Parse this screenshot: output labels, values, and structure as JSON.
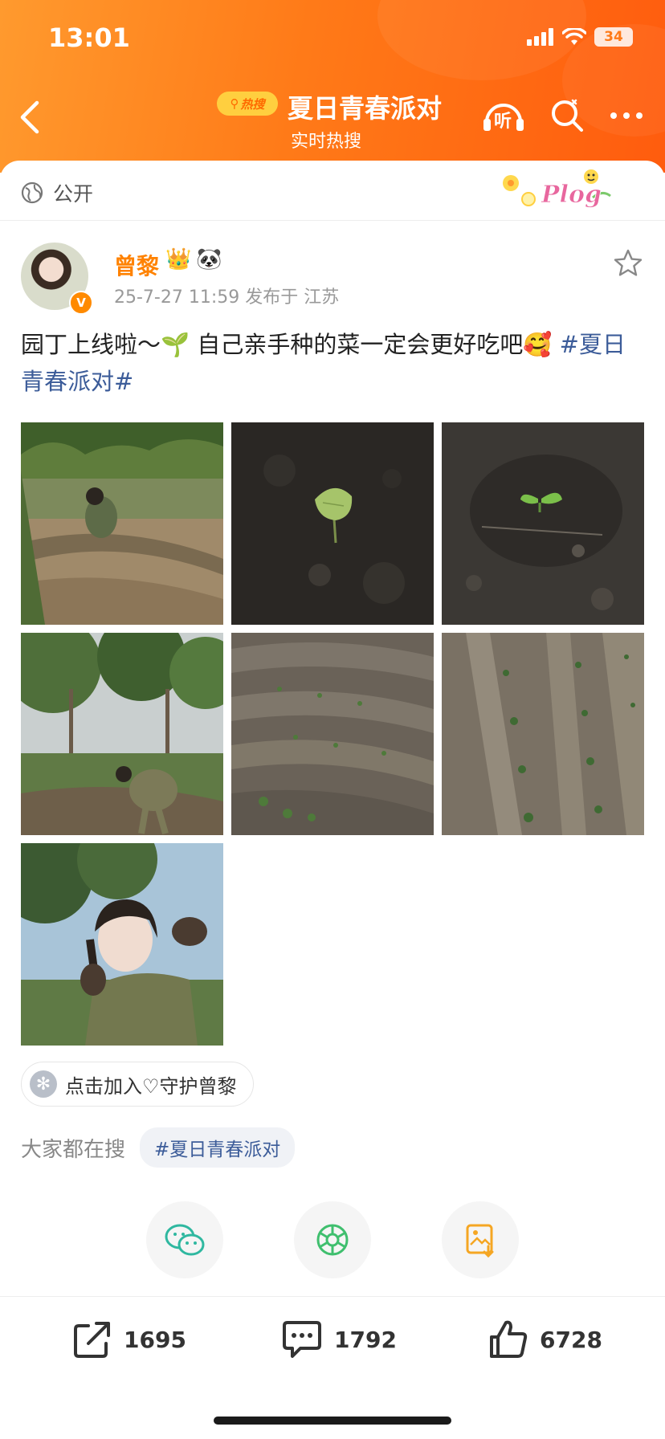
{
  "status_bar": {
    "time": "13:01",
    "battery": "34"
  },
  "nav": {
    "back_icon": "back-chevron-icon",
    "hot_badge": "热搜",
    "title": "夏日青春派对",
    "subtitle": "实时热搜",
    "listen_label": "听",
    "icons": [
      "listen-icon",
      "search-icon",
      "more-icon"
    ]
  },
  "visibility": {
    "label": "公开",
    "icon": "globe-icon",
    "sticker": "Plog"
  },
  "post": {
    "author": "曾黎",
    "meta": "25-7-27 11:59  发布于 江苏",
    "text_main": "园丁上线啦～🌱 自己亲手种的菜一定会更好吃吧🥰",
    "hashtag": "#夏日青春派对#",
    "image_count": 7
  },
  "guard_chip": {
    "label": "点击加入♡守护曾黎"
  },
  "trending": {
    "label": "大家都在搜",
    "tag": "#夏日青春派对"
  },
  "share_buttons": [
    "wechat-icon",
    "moments-icon",
    "save-image-icon"
  ],
  "actions": {
    "repost": "1695",
    "comment": "1792",
    "like": "6728"
  },
  "colors": {
    "accent": "#ff7a18",
    "link": "#3c5c99",
    "username": "#ff8200"
  }
}
